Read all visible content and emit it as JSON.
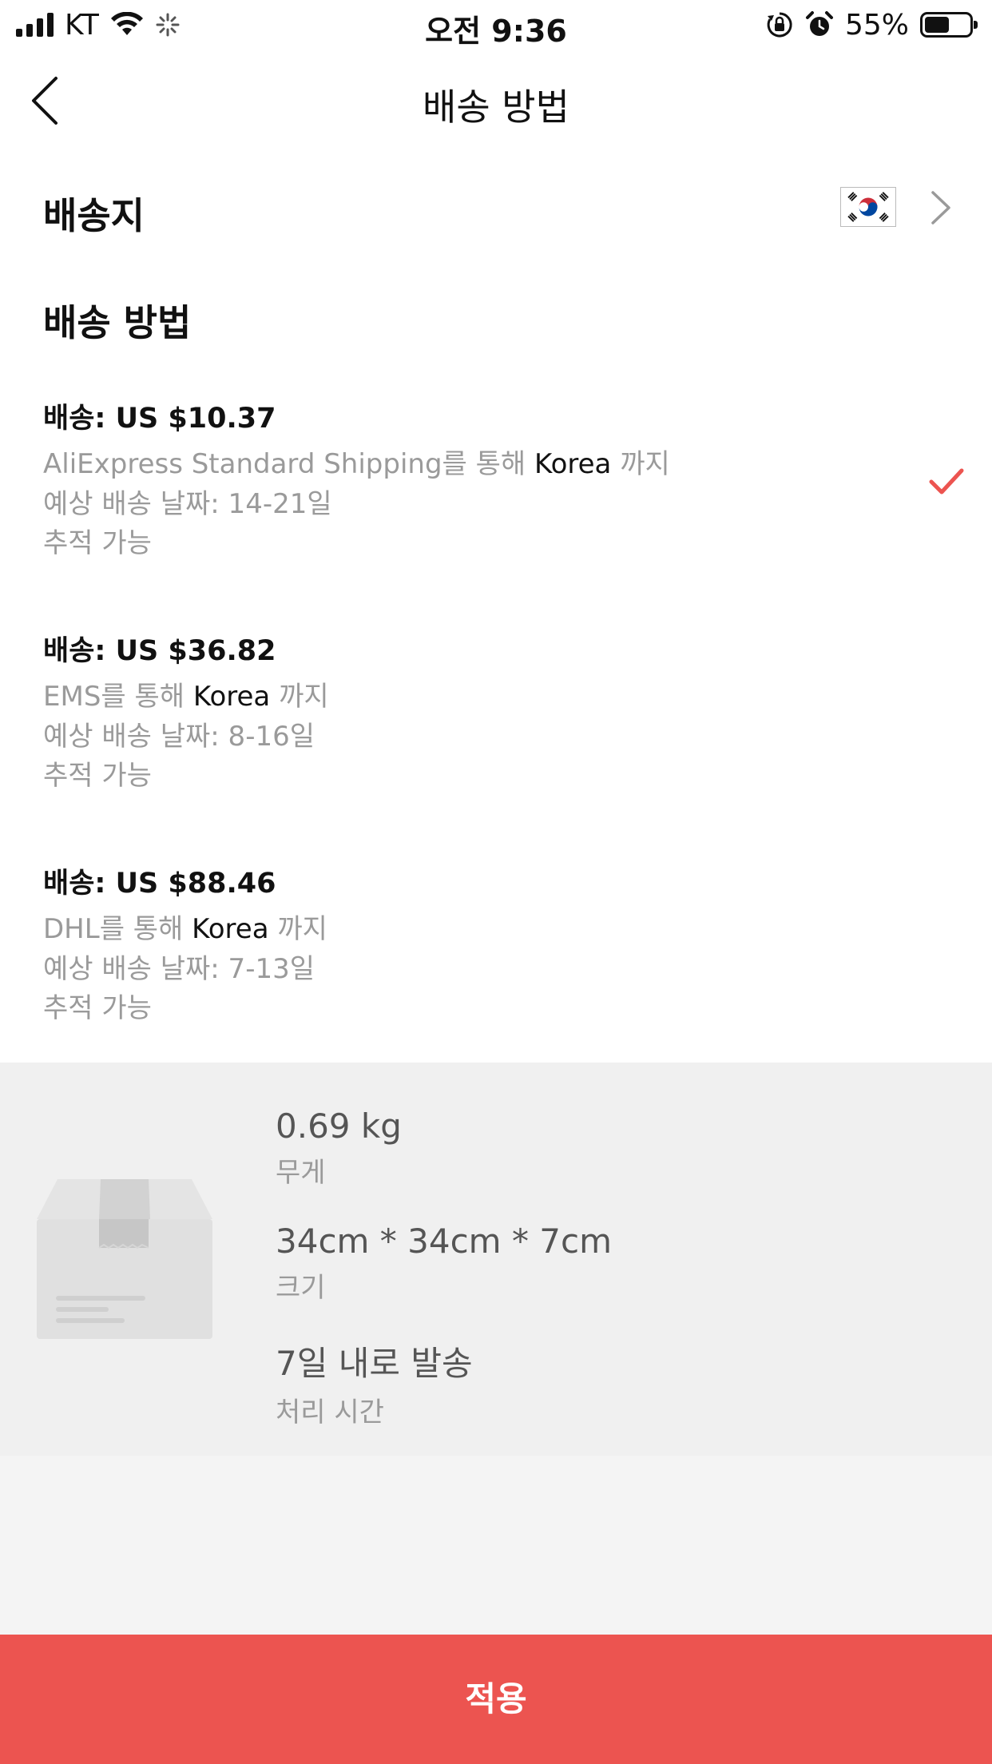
{
  "status_bar": {
    "carrier": "KT",
    "time": "오전 9:36",
    "battery_percent": "55%",
    "battery_level": 0.55
  },
  "nav": {
    "title": "배송 방법",
    "back_icon": "chevron-left-icon"
  },
  "destination": {
    "label": "배송지",
    "country_flag": "south-korea-flag-icon"
  },
  "shipping": {
    "heading": "배송 방법",
    "options": [
      {
        "price": "배송: US $10.37",
        "via_prefix": "AliExpress Standard Shipping를 통해",
        "destination": "Korea",
        "via_suffix": "까지",
        "eta": "예상 배송 날짜: 14-21일",
        "tracking": "추적 가능",
        "selected": true
      },
      {
        "price": "배송: US $36.82",
        "via_prefix": "EMS를 통해",
        "destination": "Korea",
        "via_suffix": "까지",
        "eta": "예상 배송 날짜: 8-16일",
        "tracking": "추적 가능",
        "selected": false
      },
      {
        "price": "배송: US $88.46",
        "via_prefix": "DHL를 통해",
        "destination": "Korea",
        "via_suffix": "까지",
        "eta": "예상 배송 날짜: 7-13일",
        "tracking": "추적 가능",
        "selected": false
      }
    ]
  },
  "package": {
    "weight_value": "0.69 kg",
    "weight_label": "무게",
    "size_value": "34cm * 34cm * 7cm",
    "size_label": "크기",
    "processing_value": "7일 내로 발송",
    "processing_label": "처리 시간"
  },
  "apply_button": "적용",
  "colors": {
    "accent": "#ec5450",
    "secondary_text": "#9a9a9a",
    "panel_bg": "#f0f0f0"
  }
}
